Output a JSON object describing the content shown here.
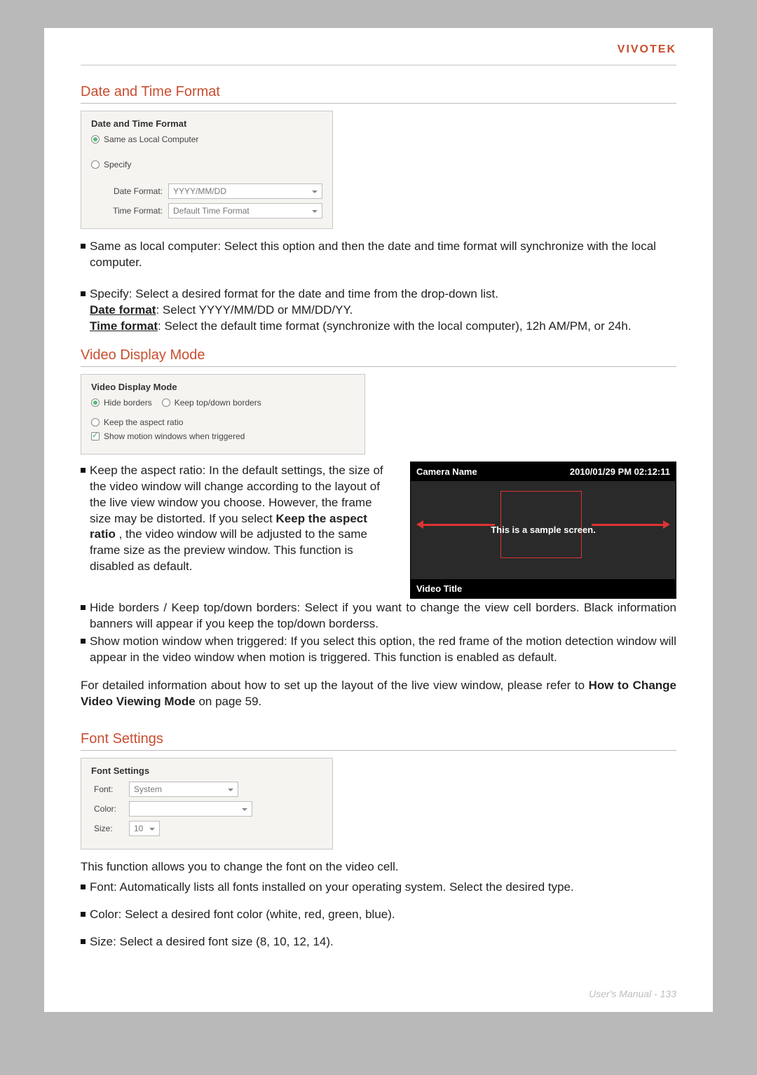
{
  "header": {
    "brand": "VIVOTEK"
  },
  "sections": {
    "datetime": {
      "title": "Date and Time Format",
      "panel": {
        "title": "Date and Time Format",
        "option_same": "Same as Local Computer",
        "option_specify": "Specify",
        "date_label": "Date Format:",
        "date_value": "YYYY/MM/DD",
        "time_label": "Time Format:",
        "time_value": "Default Time Format"
      },
      "bullets": [
        "Same as local computer: Select this option and then the date and time format will synchronize with the local computer.",
        {
          "intro": "Specify: Select a desired format for the date and time from the drop-down list.",
          "date_label": "Date format",
          "date_text": ": Select YYYY/MM/DD or MM/DD/YY.",
          "time_label": "Time format",
          "time_text": ": Select the default time format (synchronize with the local computer), 12h AM/PM, or 24h."
        }
      ]
    },
    "video": {
      "title": "Video Display Mode",
      "panel": {
        "title": "Video Display Mode",
        "opt_hide": "Hide borders",
        "opt_topdown": "Keep top/down borders",
        "opt_aspect": "Keep the aspect ratio",
        "chk_motion": "Show motion windows when triggered"
      },
      "sample": {
        "camera": "Camera Name",
        "timestamp": "2010/01/29 PM 02:12:11",
        "caption": "This is a sample screen.",
        "video_title": "Video Title"
      },
      "bullets": {
        "0": {
          "a": "Keep the aspect ratio: In the default settings, the size of the video window will change according to the layout of the live view window you choose. However, the frame size may be distorted. If you select ",
          "b": "Keep the aspect ratio",
          "c": ", the video window will be adjusted to the same frame size as the preview window. This function is disabled as default."
        },
        "1": "Hide borders / Keep top/down borders: Select if you want to change the view cell borders. Black information banners will appear if you keep the top/down borderss.",
        "2": "Show motion window when triggered: If you select this option, the red frame of the motion detection window will appear in the video window when motion is triggered. This function is enabled as default."
      },
      "note": {
        "a": "For detailed information about how to set up the layout of the live view window, please refer to ",
        "b": "How to Change Video Viewing Mode",
        "c": " on page 59."
      }
    },
    "font": {
      "title": "Font Settings",
      "panel": {
        "title": "Font Settings",
        "font_label": "Font:",
        "font_value": "System",
        "color_label": "Color:",
        "color_value": "",
        "size_label": "Size:",
        "size_value": "10"
      },
      "intro": "This function allows you to change the font on the video cell.",
      "bullets": [
        "Font: Automatically lists all fonts installed on your operating system. Select the desired type.",
        "Color: Select a desired font color (white, red, green, blue).",
        "Size: Select a desired font size (8, 10, 12, 14)."
      ]
    }
  },
  "footer": {
    "label": "User's Manual -",
    "page": "133"
  }
}
